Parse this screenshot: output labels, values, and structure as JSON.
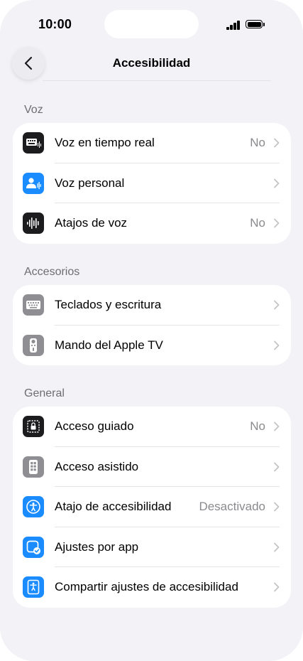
{
  "status_bar": {
    "time": "10:00"
  },
  "nav": {
    "title": "Accesibilidad"
  },
  "sections": [
    {
      "header": "Voz",
      "items": [
        {
          "label": "Voz en tiempo real",
          "value": "No",
          "icon": "keyboard-waveform-icon"
        },
        {
          "label": "Voz personal",
          "value": "",
          "icon": "person-waveform-icon"
        },
        {
          "label": "Atajos de voz",
          "value": "No",
          "icon": "waveform-icon"
        }
      ]
    },
    {
      "header": "Accesorios",
      "items": [
        {
          "label": "Teclados y escritura",
          "value": "",
          "icon": "keyboard-icon"
        },
        {
          "label": "Mando del Apple TV",
          "value": "",
          "icon": "tv-remote-icon"
        }
      ]
    },
    {
      "header": "General",
      "items": [
        {
          "label": "Acceso guiado",
          "value": "No",
          "icon": "lock-frame-icon"
        },
        {
          "label": "Acceso asistido",
          "value": "",
          "icon": "phone-grid-icon"
        },
        {
          "label": "Atajo de accesibilidad",
          "value": "Desactivado",
          "icon": "accessibility-icon"
        },
        {
          "label": "Ajustes por app",
          "value": "",
          "icon": "app-check-icon"
        },
        {
          "label": "Compartir ajustes de accesibilidad",
          "value": "",
          "icon": "share-accessibility-icon"
        }
      ]
    }
  ],
  "colors": {
    "background": "#f2f2f7",
    "accent_blue": "#1a8cff",
    "icon_dark": "#1c1c1e",
    "icon_gray": "#8e8e93",
    "secondary_text": "#8a8a8e"
  }
}
